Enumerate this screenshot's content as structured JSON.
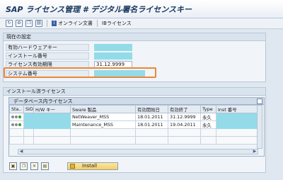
{
  "window": {
    "title": "SAP ライセンス管理 # デジタル署名ライセンスキー"
  },
  "toolbar": {
    "icons": [
      "refresh-icon",
      "settings-icon",
      "copy-icon",
      "link-icon"
    ],
    "online_doc_label": "オンライン文書",
    "ib_license_label": "IBライセンス"
  },
  "current_settings": {
    "header": "現在の設定",
    "fields": [
      {
        "label": "有効ハードウェアキー",
        "value": "",
        "masked": true
      },
      {
        "label": "インストール番号",
        "value": "",
        "masked": true
      },
      {
        "label": "ライセンス有効期限",
        "value": "31.12.9999",
        "masked": false
      },
      {
        "label": "システム番号",
        "value": "",
        "masked": true
      }
    ]
  },
  "installed_licenses": {
    "header": "インストール済ライセンス",
    "db_header": "データベース内ライセンス",
    "columns": [
      "Sta..",
      "SID",
      "H/W キー",
      "Sware 製品",
      "有効開始日",
      "有効終了",
      "Type",
      "Inst 番号"
    ],
    "rows": [
      {
        "sid": "",
        "hw_key": "",
        "product": "NetWeaver_MSS",
        "start": "18.01.2011",
        "end": "31.12.9999",
        "type": "永久",
        "inst": ""
      },
      {
        "sid": "",
        "hw_key": "",
        "product": "Maintenance_MSS",
        "start": "18.01.2011",
        "end": "19.04.2011",
        "type": "永久",
        "inst": ""
      }
    ],
    "install_button": "Install"
  }
}
